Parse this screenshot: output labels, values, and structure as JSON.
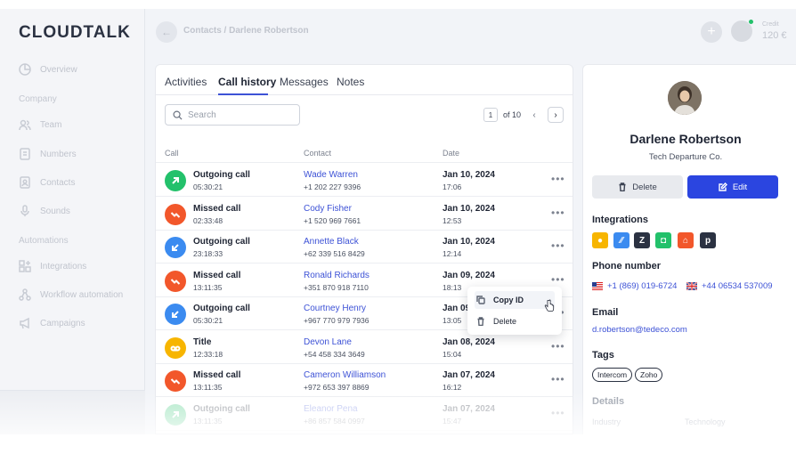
{
  "sidebar": {
    "logo": "CLOUDTALK",
    "overview": "Overview",
    "section_company": "Company",
    "team": "Team",
    "numbers": "Numbers",
    "contacts": "Contacts",
    "sounds": "Sounds",
    "section_automations": "Automations",
    "integrations": "Integrations",
    "workflow": "Workflow automation",
    "campaigns": "Campaigns"
  },
  "header": {
    "breadcrumb": "Contacts / Darlene Robertson",
    "credit_label": "Credit",
    "credit_value": "120 €"
  },
  "tabs": [
    "Activities",
    "Call history",
    "Messages",
    "Notes"
  ],
  "search": {
    "placeholder": "Search"
  },
  "pager": {
    "page": "1",
    "of": "of 10"
  },
  "columns": {
    "call": "Call",
    "contact": "Contact",
    "date": "Date"
  },
  "rows": [
    {
      "type": "Outgoing call",
      "duration": "05:30:21",
      "name": "Wade Warren",
      "phone": "+1 202 227 9396",
      "date": "Jan 10, 2024",
      "time": "17:06",
      "kind": "outgoing-green"
    },
    {
      "type": "Missed call",
      "duration": "02:33:48",
      "name": "Cody Fisher",
      "phone": "+1 520 969 7661",
      "date": "Jan 10, 2024",
      "time": "12:53",
      "kind": "missed"
    },
    {
      "type": "Outgoing call",
      "duration": "23:18:33",
      "name": "Annette Black",
      "phone": "+62 339 516 8429",
      "date": "Jan 10, 2024",
      "time": "12:14",
      "kind": "incoming-blue"
    },
    {
      "type": "Missed call",
      "duration": "13:11:35",
      "name": "Ronald Richards",
      "phone": "+351 870 918 7110",
      "date": "Jan 09, 2024",
      "time": "18:13",
      "kind": "missed"
    },
    {
      "type": "Outgoing call",
      "duration": "05:30:21",
      "name": "Courtney Henry",
      "phone": "+967 770 979 7936",
      "date": "Jan 09",
      "time": "13:05",
      "kind": "incoming-blue"
    },
    {
      "type": "Title",
      "duration": "12:33:18",
      "name": "Devon Lane",
      "phone": "+54 458 334 3649",
      "date": "Jan 08, 2024",
      "time": "15:04",
      "kind": "voicemail"
    },
    {
      "type": "Missed call",
      "duration": "13:11:35",
      "name": "Cameron Williamson",
      "phone": "+972 653 397 8869",
      "date": "Jan 07, 2024",
      "time": "16:12",
      "kind": "missed"
    },
    {
      "type": "Outgoing call",
      "duration": "13:11:35",
      "name": "Eleanor Pena",
      "phone": "+86 857 584 0997",
      "date": "Jan 07, 2024",
      "time": "15:47",
      "kind": "outgoing-green"
    }
  ],
  "context_menu": {
    "copy": "Copy ID",
    "delete": "Delete"
  },
  "contact": {
    "name": "Darlene Robertson",
    "company": "Tech Departure Co.",
    "delete_label": "Delete",
    "edit_label": "Edit",
    "integrations_title": "Integrations",
    "phone_title": "Phone number",
    "phone_us": "+1 (869) 019-6724",
    "phone_uk": "+44 06534 537009",
    "email_title": "Email",
    "email": "d.robertson@tedeco.com",
    "tags_title": "Tags",
    "tags": [
      "Intercom",
      "Zoho"
    ],
    "details_title": "Details",
    "detail_key": "Industry",
    "detail_value": "Technology"
  },
  "colors": {
    "accent": "#2b45e0",
    "green": "#23c16b",
    "orange": "#f2572b",
    "blue": "#3b8bf0",
    "yellow": "#f7b500"
  }
}
